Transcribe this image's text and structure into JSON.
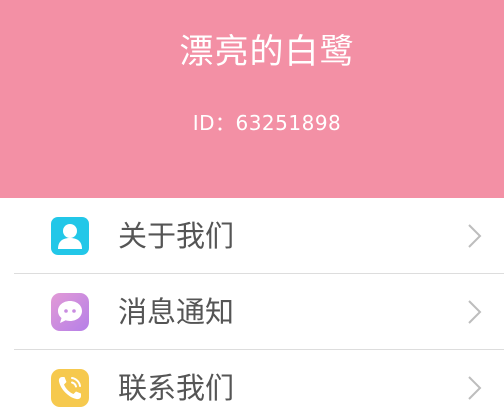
{
  "colors": {
    "header_bg": "#f390a5",
    "about_icon": "#22c7e8",
    "message_icon": "#c98ce0",
    "contact_icon": "#f6c94e",
    "divider": "#dddddd",
    "label_text": "#555555"
  },
  "profile": {
    "nickname": "漂亮的白鹭",
    "id_text": "ID：63251898"
  },
  "menu": {
    "items": [
      {
        "label": "关于我们",
        "icon": "user-icon"
      },
      {
        "label": "消息通知",
        "icon": "chat-bubble-icon"
      },
      {
        "label": "联系我们",
        "icon": "phone-icon"
      }
    ]
  }
}
